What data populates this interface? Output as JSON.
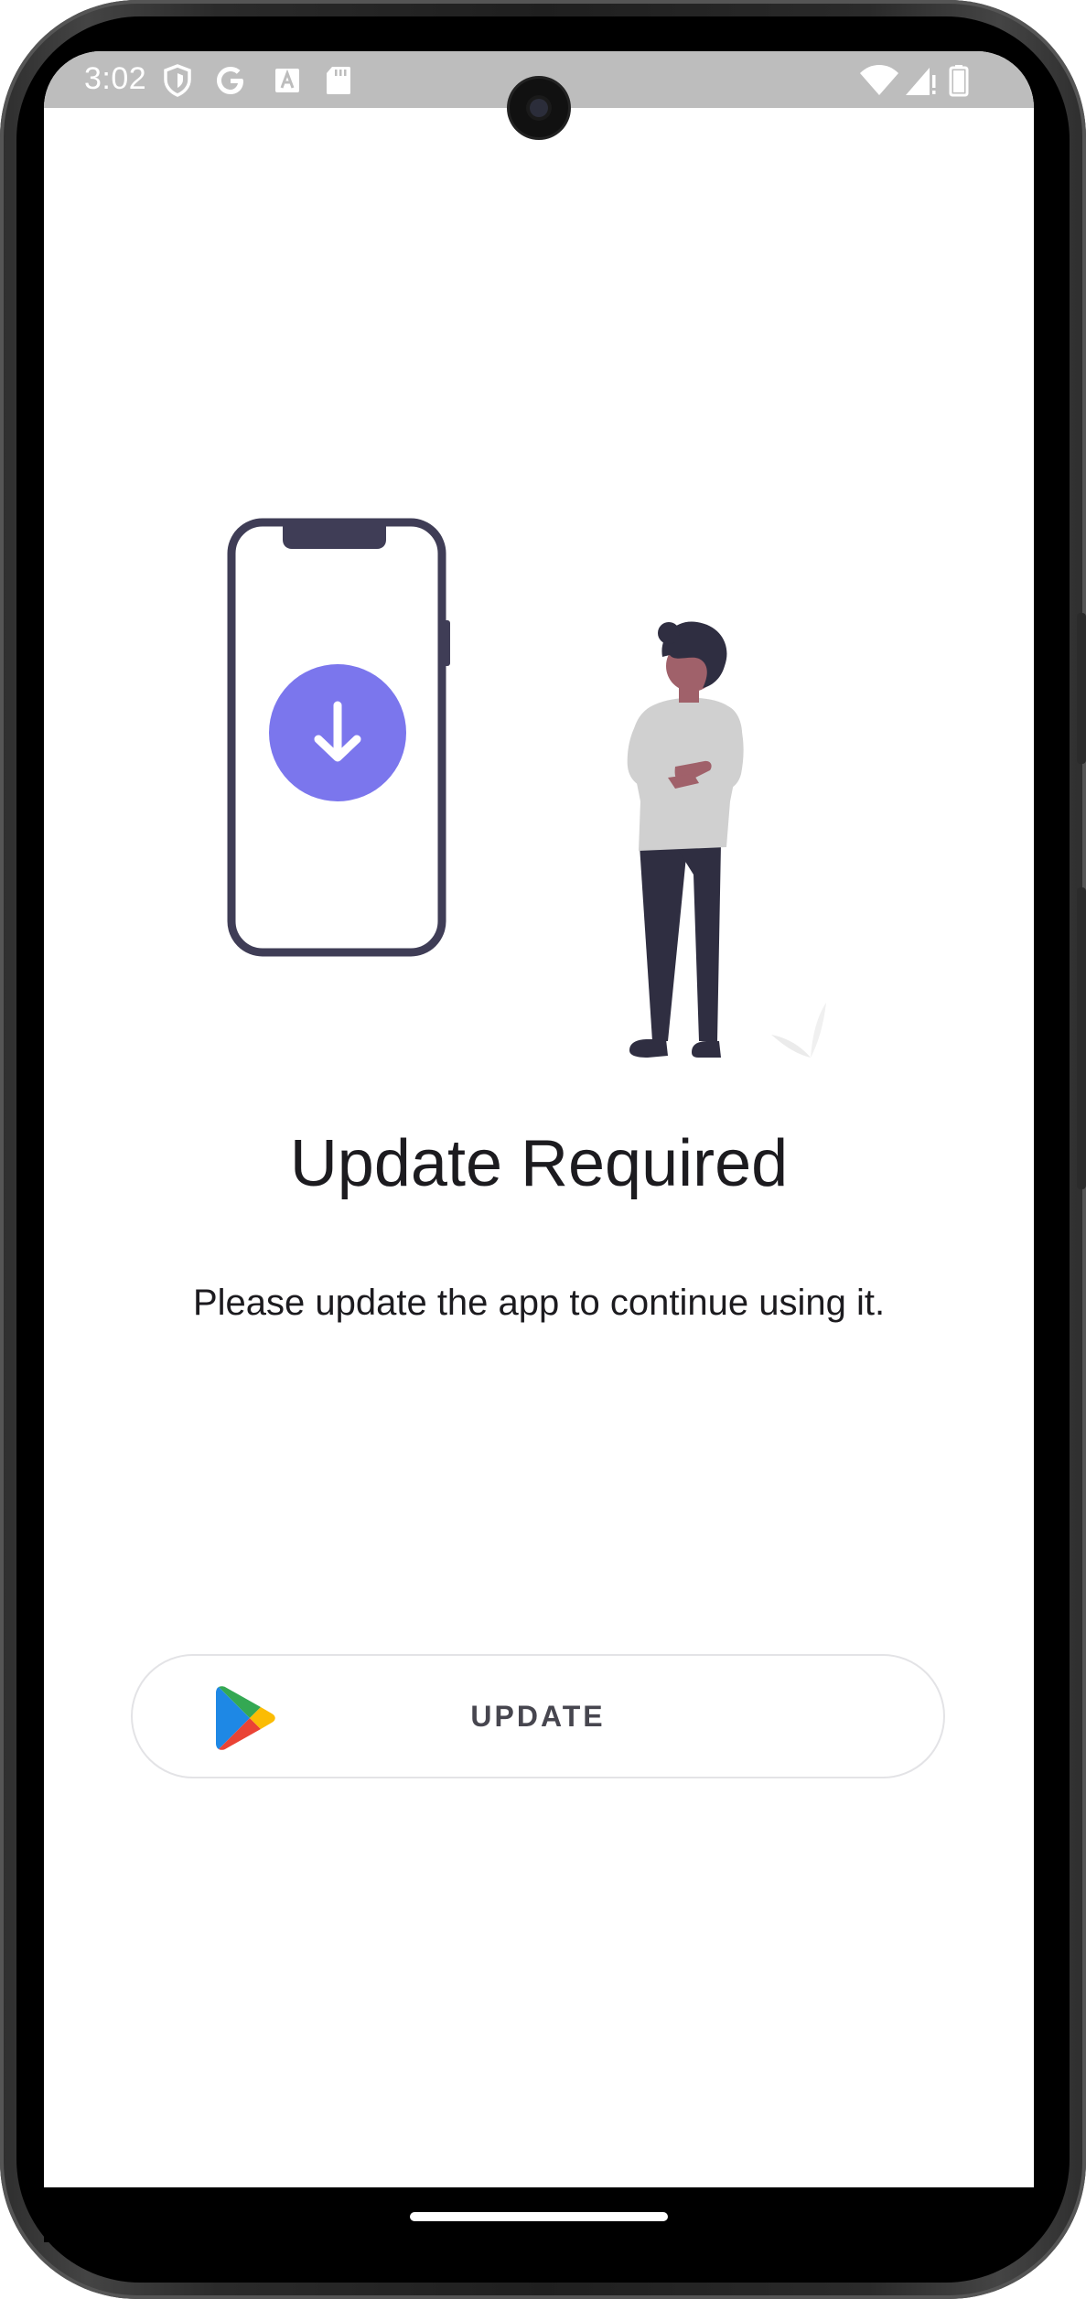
{
  "status_bar": {
    "time": "3:02",
    "left_icons": [
      "shield-icon",
      "google-icon",
      "text-a-icon",
      "sd-card-icon"
    ],
    "right_icons": [
      "wifi-icon",
      "cellular-signal-icon",
      "battery-icon"
    ]
  },
  "main": {
    "title": "Update Required",
    "message": "Please update the app to continue using it.",
    "update_button": {
      "label": "UPDATE",
      "icon": "google-play-icon"
    }
  },
  "illustration": {
    "icons": [
      "phone-outline",
      "download-arrow-icon",
      "person-figure"
    ],
    "accent_color": "#7b76ed",
    "outline_color": "#3f3d56"
  },
  "navigation": {
    "home_indicator": "home-indicator"
  }
}
